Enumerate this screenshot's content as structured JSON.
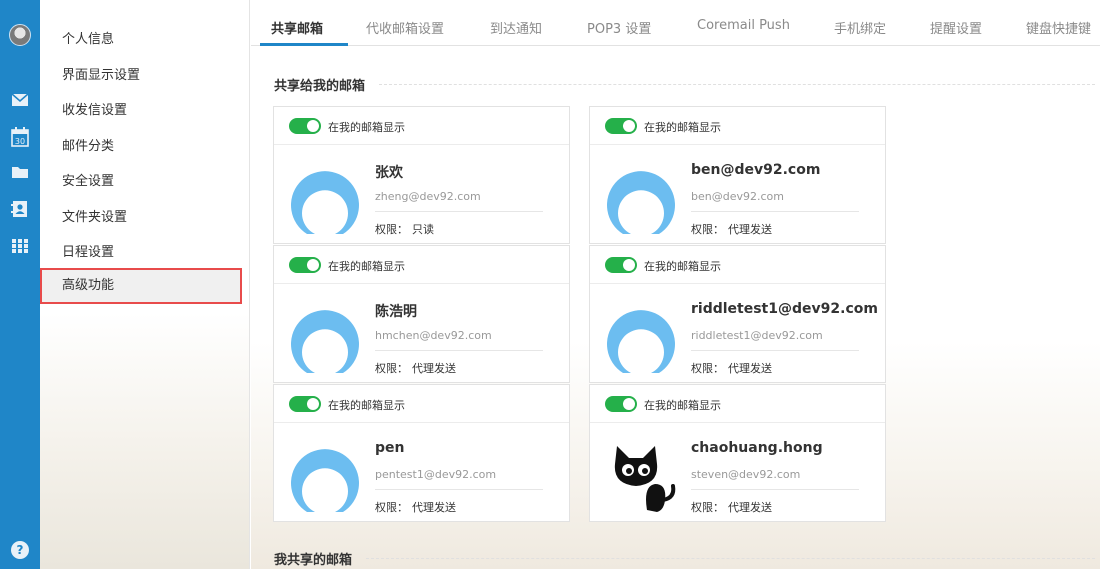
{
  "sidebar": {
    "icons": [
      "avatar",
      "mail-icon",
      "calendar-icon",
      "folder-icon",
      "contacts-icon",
      "apps-grid-icon",
      "help-icon"
    ],
    "calendar_day": "30",
    "help_glyph": "?"
  },
  "settings_menu": {
    "items": [
      "个人信息",
      "界面显示设置",
      "收发信设置",
      "邮件分类",
      "安全设置",
      "文件夹设置",
      "日程设置",
      "高级功能"
    ],
    "highlighted": "高级功能"
  },
  "tabs": [
    "共享邮箱",
    "代收邮箱设置",
    "到达通知",
    "POP3 设置",
    "Coremail Push",
    "手机绑定",
    "提醒设置",
    "键盘快捷键"
  ],
  "active_tab": "共享邮箱",
  "shared_to_me": {
    "title": "共享给我的邮箱",
    "toggle_label": "在我的邮箱显示",
    "perm_prefix": "权限：",
    "cards": [
      {
        "name": "张欢",
        "email": "zheng@dev92.com",
        "permission": "只读",
        "avatar": "default-avatar",
        "show": true
      },
      {
        "name": "ben@dev92.com",
        "email": "ben@dev92.com",
        "permission": "代理发送",
        "avatar": "default-avatar",
        "show": true
      },
      {
        "name": "陈浩明",
        "email": "hmchen@dev92.com",
        "permission": "代理发送",
        "avatar": "default-avatar",
        "show": true
      },
      {
        "name": "riddletest1@dev92.com",
        "email": "riddletest1@dev92.com",
        "permission": "代理发送",
        "avatar": "default-avatar",
        "show": true
      },
      {
        "name": "pen",
        "email": "pentest1@dev92.com",
        "permission": "代理发送",
        "avatar": "default-avatar",
        "show": true
      },
      {
        "name": "chaohuang.hong",
        "email": "steven@dev92.com",
        "permission": "代理发送",
        "avatar": "cat-avatar",
        "show": true
      }
    ]
  },
  "my_shared": {
    "title": "我共享的邮箱"
  },
  "colors": {
    "accent": "#1f86c8",
    "toggle_on": "#25b04a",
    "highlight_border": "#e84b4b",
    "avatar_blue": "#6cbdf0"
  }
}
